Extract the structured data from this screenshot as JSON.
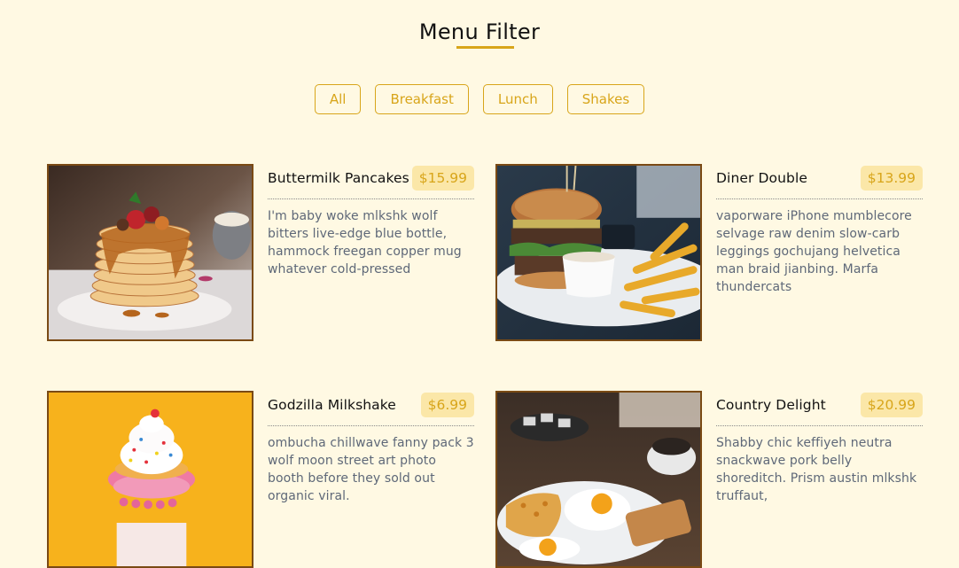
{
  "page": {
    "title": "Menu Filter"
  },
  "filters": [
    {
      "label": "All"
    },
    {
      "label": "Breakfast"
    },
    {
      "label": "Lunch"
    },
    {
      "label": "Shakes"
    }
  ],
  "colors": {
    "background": "#fff9e3",
    "accent": "#d8a51a",
    "price_bg": "#fbe7a8",
    "photo_border": "#7a4a14",
    "description": "#5e6878"
  },
  "menu": [
    {
      "name": "Buttermilk Pancakes",
      "price": "$15.99",
      "description": "I'm baby woke mlkshk wolf bitters live-edge blue bottle, hammock freegan copper mug whatever cold-pressed",
      "image": "pancakes-photo"
    },
    {
      "name": "Diner Double",
      "price": "$13.99",
      "description": "vaporware iPhone mumblecore selvage raw denim slow-carb leggings gochujang helvetica man braid jianbing. Marfa thundercats",
      "image": "burger-photo"
    },
    {
      "name": "Godzilla Milkshake",
      "price": "$6.99",
      "description": "ombucha chillwave fanny pack 3 wolf moon street art photo booth before they sold out organic viral.",
      "image": "milkshake-photo"
    },
    {
      "name": "Country Delight",
      "price": "$20.99",
      "description": "Shabby chic keffiyeh neutra snackwave pork belly shoreditch. Prism austin mlkshk truffaut,",
      "image": "breakfast-plate-photo"
    }
  ]
}
